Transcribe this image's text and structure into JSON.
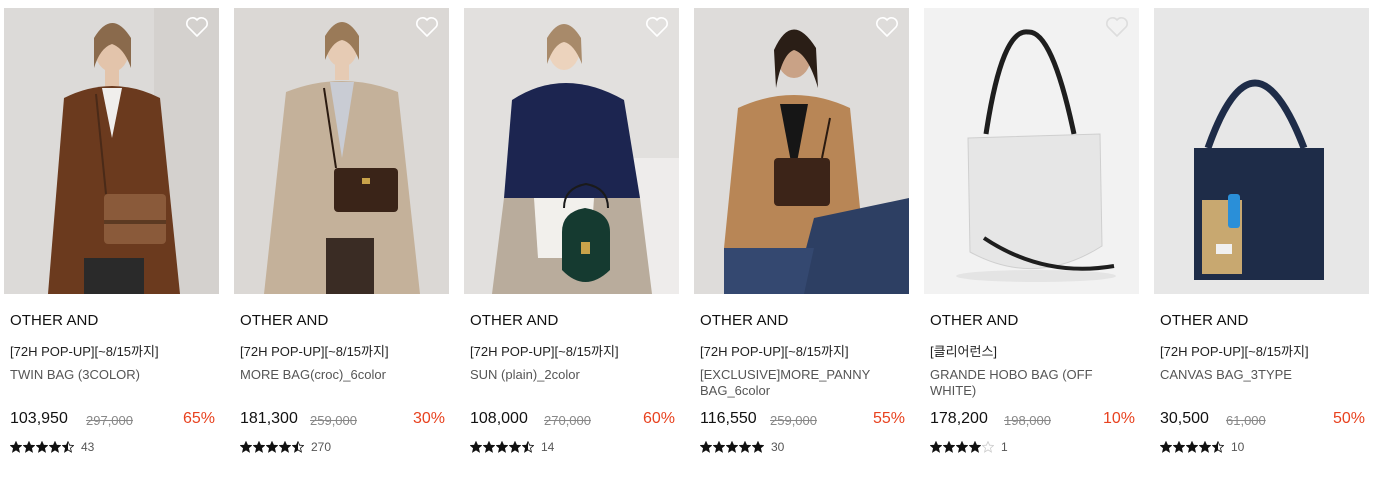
{
  "products": [
    {
      "brand": "OTHER AND",
      "tag": "[72H POP-UP][~8/15까지]",
      "name": "TWIN BAG (3COLOR)",
      "price": "103,950",
      "original_price": "297,000",
      "discount": "65%",
      "rating": 4.5,
      "review_count": "43"
    },
    {
      "brand": "OTHER AND",
      "tag": "[72H POP-UP][~8/15까지]",
      "name": "MORE BAG(croc)_6color",
      "price": "181,300",
      "original_price": "259,000",
      "discount": "30%",
      "rating": 4.5,
      "review_count": "270"
    },
    {
      "brand": "OTHER AND",
      "tag": "[72H POP-UP][~8/15까지]",
      "name": "SUN (plain)_2color",
      "price": "108,000",
      "original_price": "270,000",
      "discount": "60%",
      "rating": 4.5,
      "review_count": "14"
    },
    {
      "brand": "OTHER AND",
      "tag": "[72H POP-UP][~8/15까지]",
      "name": "[EXCLUSIVE]MORE_PANNY BAG_6color",
      "price": "116,550",
      "original_price": "259,000",
      "discount": "55%",
      "rating": 5,
      "review_count": "30"
    },
    {
      "brand": "OTHER AND",
      "tag": "[클리어런스]",
      "name": "GRANDE HOBO BAG (OFF WHITE)",
      "price": "178,200",
      "original_price": "198,000",
      "discount": "10%",
      "rating": 4,
      "review_count": "1"
    },
    {
      "brand": "OTHER AND",
      "tag": "[72H POP-UP][~8/15까지]",
      "name": "CANVAS BAG_3TYPE",
      "price": "30,500",
      "original_price": "61,000",
      "discount": "50%",
      "rating": 4.5,
      "review_count": "10"
    }
  ],
  "icons": {
    "wishlist": "heart-outline-icon",
    "rating": "star-icon"
  },
  "colors": {
    "discount": "#e8421f",
    "star": "#111111",
    "star_empty": "#cccccc"
  }
}
